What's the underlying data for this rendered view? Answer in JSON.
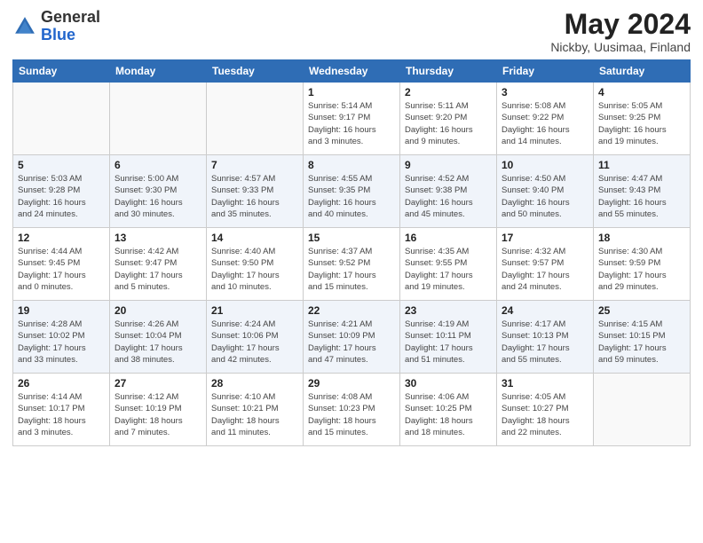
{
  "logo": {
    "general": "General",
    "blue": "Blue"
  },
  "title": "May 2024",
  "location": "Nickby, Uusimaa, Finland",
  "days_of_week": [
    "Sunday",
    "Monday",
    "Tuesday",
    "Wednesday",
    "Thursday",
    "Friday",
    "Saturday"
  ],
  "weeks": [
    [
      {
        "day": "",
        "info": ""
      },
      {
        "day": "",
        "info": ""
      },
      {
        "day": "",
        "info": ""
      },
      {
        "day": "1",
        "info": "Sunrise: 5:14 AM\nSunset: 9:17 PM\nDaylight: 16 hours\nand 3 minutes."
      },
      {
        "day": "2",
        "info": "Sunrise: 5:11 AM\nSunset: 9:20 PM\nDaylight: 16 hours\nand 9 minutes."
      },
      {
        "day": "3",
        "info": "Sunrise: 5:08 AM\nSunset: 9:22 PM\nDaylight: 16 hours\nand 14 minutes."
      },
      {
        "day": "4",
        "info": "Sunrise: 5:05 AM\nSunset: 9:25 PM\nDaylight: 16 hours\nand 19 minutes."
      }
    ],
    [
      {
        "day": "5",
        "info": "Sunrise: 5:03 AM\nSunset: 9:28 PM\nDaylight: 16 hours\nand 24 minutes."
      },
      {
        "day": "6",
        "info": "Sunrise: 5:00 AM\nSunset: 9:30 PM\nDaylight: 16 hours\nand 30 minutes."
      },
      {
        "day": "7",
        "info": "Sunrise: 4:57 AM\nSunset: 9:33 PM\nDaylight: 16 hours\nand 35 minutes."
      },
      {
        "day": "8",
        "info": "Sunrise: 4:55 AM\nSunset: 9:35 PM\nDaylight: 16 hours\nand 40 minutes."
      },
      {
        "day": "9",
        "info": "Sunrise: 4:52 AM\nSunset: 9:38 PM\nDaylight: 16 hours\nand 45 minutes."
      },
      {
        "day": "10",
        "info": "Sunrise: 4:50 AM\nSunset: 9:40 PM\nDaylight: 16 hours\nand 50 minutes."
      },
      {
        "day": "11",
        "info": "Sunrise: 4:47 AM\nSunset: 9:43 PM\nDaylight: 16 hours\nand 55 minutes."
      }
    ],
    [
      {
        "day": "12",
        "info": "Sunrise: 4:44 AM\nSunset: 9:45 PM\nDaylight: 17 hours\nand 0 minutes."
      },
      {
        "day": "13",
        "info": "Sunrise: 4:42 AM\nSunset: 9:47 PM\nDaylight: 17 hours\nand 5 minutes."
      },
      {
        "day": "14",
        "info": "Sunrise: 4:40 AM\nSunset: 9:50 PM\nDaylight: 17 hours\nand 10 minutes."
      },
      {
        "day": "15",
        "info": "Sunrise: 4:37 AM\nSunset: 9:52 PM\nDaylight: 17 hours\nand 15 minutes."
      },
      {
        "day": "16",
        "info": "Sunrise: 4:35 AM\nSunset: 9:55 PM\nDaylight: 17 hours\nand 19 minutes."
      },
      {
        "day": "17",
        "info": "Sunrise: 4:32 AM\nSunset: 9:57 PM\nDaylight: 17 hours\nand 24 minutes."
      },
      {
        "day": "18",
        "info": "Sunrise: 4:30 AM\nSunset: 9:59 PM\nDaylight: 17 hours\nand 29 minutes."
      }
    ],
    [
      {
        "day": "19",
        "info": "Sunrise: 4:28 AM\nSunset: 10:02 PM\nDaylight: 17 hours\nand 33 minutes."
      },
      {
        "day": "20",
        "info": "Sunrise: 4:26 AM\nSunset: 10:04 PM\nDaylight: 17 hours\nand 38 minutes."
      },
      {
        "day": "21",
        "info": "Sunrise: 4:24 AM\nSunset: 10:06 PM\nDaylight: 17 hours\nand 42 minutes."
      },
      {
        "day": "22",
        "info": "Sunrise: 4:21 AM\nSunset: 10:09 PM\nDaylight: 17 hours\nand 47 minutes."
      },
      {
        "day": "23",
        "info": "Sunrise: 4:19 AM\nSunset: 10:11 PM\nDaylight: 17 hours\nand 51 minutes."
      },
      {
        "day": "24",
        "info": "Sunrise: 4:17 AM\nSunset: 10:13 PM\nDaylight: 17 hours\nand 55 minutes."
      },
      {
        "day": "25",
        "info": "Sunrise: 4:15 AM\nSunset: 10:15 PM\nDaylight: 17 hours\nand 59 minutes."
      }
    ],
    [
      {
        "day": "26",
        "info": "Sunrise: 4:14 AM\nSunset: 10:17 PM\nDaylight: 18 hours\nand 3 minutes."
      },
      {
        "day": "27",
        "info": "Sunrise: 4:12 AM\nSunset: 10:19 PM\nDaylight: 18 hours\nand 7 minutes."
      },
      {
        "day": "28",
        "info": "Sunrise: 4:10 AM\nSunset: 10:21 PM\nDaylight: 18 hours\nand 11 minutes."
      },
      {
        "day": "29",
        "info": "Sunrise: 4:08 AM\nSunset: 10:23 PM\nDaylight: 18 hours\nand 15 minutes."
      },
      {
        "day": "30",
        "info": "Sunrise: 4:06 AM\nSunset: 10:25 PM\nDaylight: 18 hours\nand 18 minutes."
      },
      {
        "day": "31",
        "info": "Sunrise: 4:05 AM\nSunset: 10:27 PM\nDaylight: 18 hours\nand 22 minutes."
      },
      {
        "day": "",
        "info": ""
      }
    ]
  ]
}
